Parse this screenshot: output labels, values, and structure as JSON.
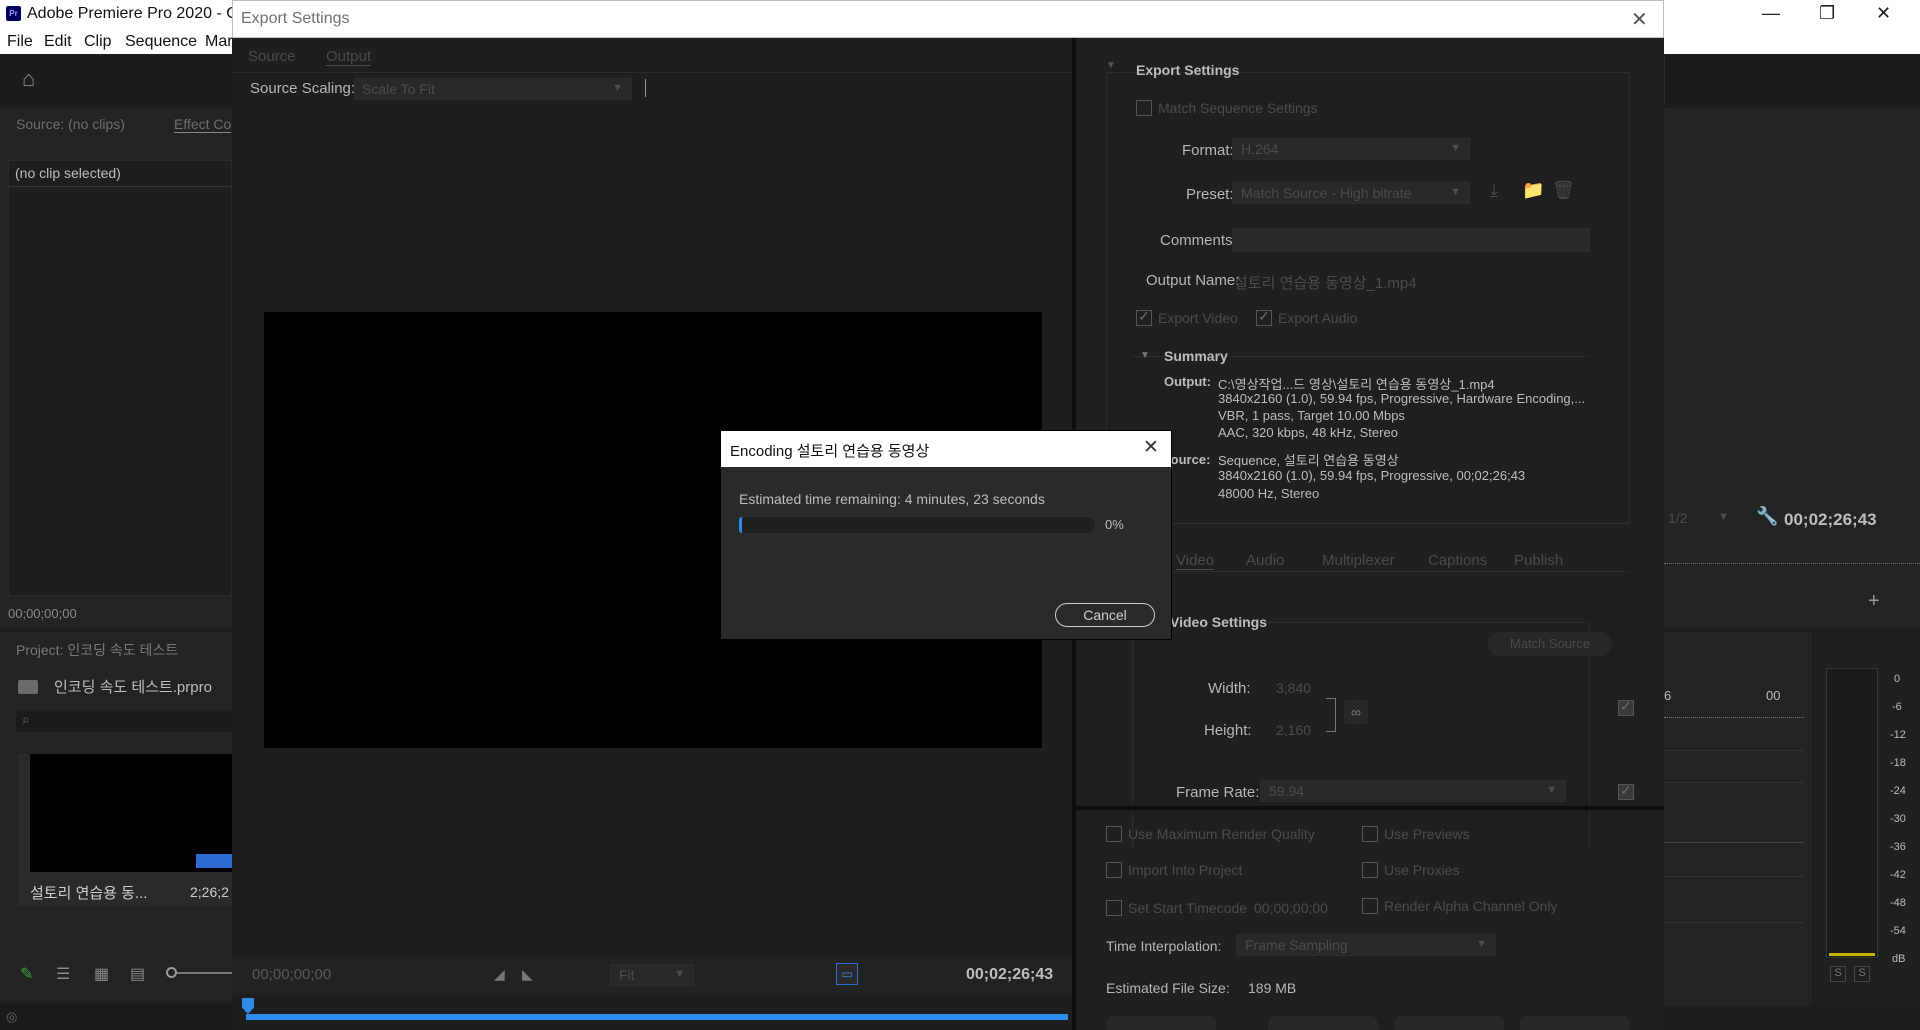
{
  "app": {
    "title": "Adobe Premiere Pro 2020 - C:",
    "menu": [
      "File",
      "Edit",
      "Clip",
      "Sequence",
      "Mar"
    ]
  },
  "left_panel": {
    "source_tab": "Source: (no clips)",
    "effect_tab": "Effect Co",
    "no_clip": "(no clip selected)",
    "timecode": "00;00;00;00",
    "project_tab": "Project: 인코딩 속도 테스트",
    "project_file": "인코딩 속도 테스트.prpro",
    "clip_name": "설토리 연습용 동...",
    "clip_duration": "2;26;2"
  },
  "right_panel": {
    "zoom": "1/2",
    "timecode": "00;02;26;43",
    "ruler_left": "6",
    "ruler_right": "00",
    "meter_ticks": [
      "0",
      "-6",
      "-12",
      "-18",
      "-24",
      "-30",
      "-36",
      "-42",
      "-48",
      "-54",
      "dB"
    ],
    "solo_labels": [
      "S",
      "S"
    ]
  },
  "export_dialog": {
    "title": "Export Settings",
    "tabs": [
      "Source",
      "Output"
    ],
    "source_scaling_label": "Source Scaling:",
    "source_scaling_value": "Scale To Fit",
    "bottom_timecode_left": "00;00;00;00",
    "fit_value": "Fit",
    "bottom_timecode_right": "00;02;26;43",
    "settings": {
      "header": "Export Settings",
      "match_sequence": "Match Sequence Settings",
      "format_label": "Format:",
      "format_value": "H.264",
      "preset_label": "Preset:",
      "preset_value": "Match Source - High bitrate",
      "comments_label": "Comments:",
      "output_name_label": "Output Name:",
      "output_name_value": "설토리 연습용 동영상_1.mp4",
      "export_video": "Export Video",
      "export_audio": "Export Audio",
      "summary_header": "Summary",
      "output_label": "Output:",
      "output_lines": [
        "C:\\영상작업...드 영상\\설토리 연습용 동영상_1.mp4",
        "3840x2160 (1.0), 59.94 fps, Progressive, Hardware Encoding,...",
        "VBR, 1 pass, Target 10.00 Mbps",
        "AAC, 320 kbps, 48 kHz, Stereo"
      ],
      "source_label": "Source:",
      "source_lines": [
        "Sequence, 설토리 연습용 동영상",
        "3840x2160 (1.0), 59.94 fps, Progressive, 00;02;26;43",
        "48000 Hz, Stereo"
      ],
      "sub_tabs": [
        "Video",
        "Audio",
        "Multiplexer",
        "Captions",
        "Publish"
      ],
      "video_settings_header": "Video Settings",
      "match_source_button": "Match Source",
      "width_label": "Width:",
      "width_value": "3,840",
      "height_label": "Height:",
      "height_value": "2,160",
      "frame_rate_label": "Frame Rate:",
      "frame_rate_value": "59.94"
    },
    "options": {
      "max_render": "Use Maximum Render Quality",
      "use_previews": "Use Previews",
      "import_project": "Import Into Project",
      "use_proxies": "Use Proxies",
      "set_start_tc": "Set Start Timecode",
      "start_tc_value": "00;00;00;00",
      "render_alpha": "Render Alpha Channel Only",
      "time_interp_label": "Time Interpolation:",
      "time_interp_value": "Frame Sampling",
      "file_size_label": "Estimated File Size:",
      "file_size_value": "189 MB"
    }
  },
  "encoding_dialog": {
    "title": "Encoding 설토리 연습용 동영상",
    "estimate": "Estimated time remaining: 4 minutes, 23 seconds",
    "progress_percent": 0,
    "progress_label": "0%",
    "cancel_button": "Cancel"
  },
  "colors": {
    "accent": "#2d8ceb",
    "dialog_bg": "#1e1e1e",
    "panel_bg": "#232323"
  }
}
